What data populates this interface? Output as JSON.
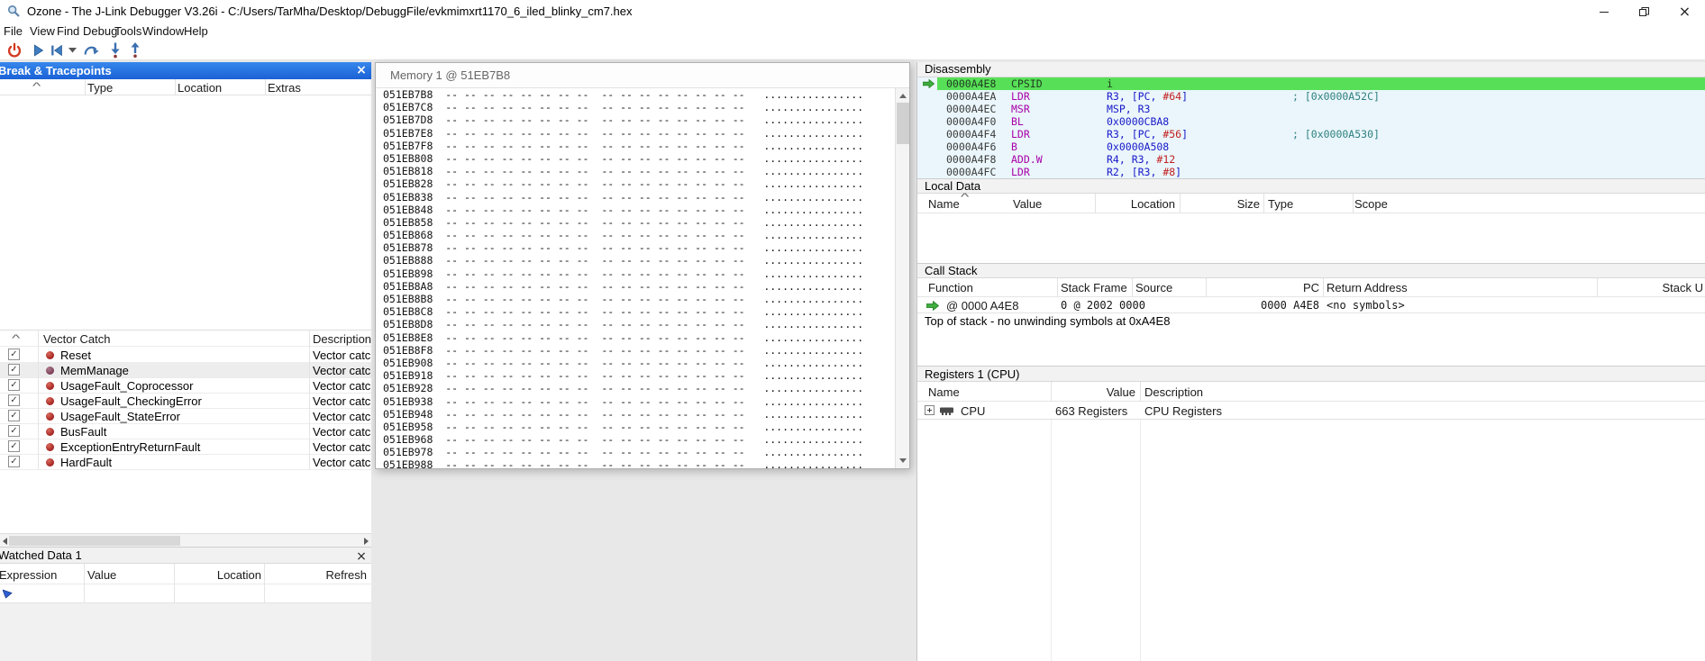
{
  "window": {
    "title": "Ozone - The J-Link Debugger V3.26i - C:/Users/TarMha/Desktop/DebuggFile/evkmimxrt1170_6_iled_blinky_cm7.hex"
  },
  "ui": {
    "close_glyph": "×"
  },
  "menu": {
    "items": [
      "File",
      "View",
      "Find",
      "Debug",
      "Tools",
      "Window",
      "Help"
    ]
  },
  "toolbar": {
    "icons": [
      "power",
      "start-debug",
      "reset",
      "reset-dropdown",
      "step-over",
      "step-into",
      "step-out"
    ]
  },
  "break_tracepoints": {
    "title": "Break & Tracepoints",
    "columns": [
      "Type",
      "Location",
      "Extras"
    ],
    "vector_catch": {
      "label": "Vector Catch",
      "description_header": "Description",
      "rows": [
        {
          "name": "Reset",
          "checked": true,
          "selected": false,
          "description": "Vector catch on"
        },
        {
          "name": "MemManage",
          "checked": true,
          "selected": true,
          "description": "Vector catch on"
        },
        {
          "name": "UsageFault_Coprocessor",
          "checked": true,
          "selected": false,
          "description": "Vector catch on"
        },
        {
          "name": "UsageFault_CheckingError",
          "checked": true,
          "selected": false,
          "description": "Vector catch on"
        },
        {
          "name": "UsageFault_StateError",
          "checked": true,
          "selected": false,
          "description": "Vector catch on"
        },
        {
          "name": "BusFault",
          "checked": true,
          "selected": false,
          "description": "Vector catch on"
        },
        {
          "name": "ExceptionEntryReturnFault",
          "checked": true,
          "selected": false,
          "description": "Vector catch on"
        },
        {
          "name": "HardFault",
          "checked": true,
          "selected": false,
          "description": "Vector catch on"
        }
      ]
    }
  },
  "watched_data": {
    "title": "Watched Data 1",
    "columns": [
      "Expression",
      "Value",
      "Location",
      "Refresh"
    ]
  },
  "memory_window": {
    "title": "Memory 1 @ 51EB7B8",
    "hex_pattern": "-- -- -- -- -- -- -- --  -- -- -- -- -- -- -- --",
    "ascii_pattern": "................",
    "addresses": [
      "051EB7B8",
      "051EB7C8",
      "051EB7D8",
      "051EB7E8",
      "051EB7F8",
      "051EB808",
      "051EB818",
      "051EB828",
      "051EB838",
      "051EB848",
      "051EB858",
      "051EB868",
      "051EB878",
      "051EB888",
      "051EB898",
      "051EB8A8",
      "051EB8B8",
      "051EB8C8",
      "051EB8D8",
      "051EB8E8",
      "051EB8F8",
      "051EB908",
      "051EB918",
      "051EB928",
      "051EB938",
      "051EB948",
      "051EB958",
      "051EB968",
      "051EB978",
      "051EB988"
    ]
  },
  "disassembly": {
    "title": "Disassembly",
    "rows": [
      {
        "address": "0000A4E8",
        "mnemonic": "CPSID",
        "operands": [
          {
            "text": "i",
            "type": "op"
          }
        ],
        "comment": "",
        "current": true
      },
      {
        "address": "0000A4EA",
        "mnemonic": "LDR",
        "operands": [
          {
            "text": "R3, [PC, ",
            "type": "op"
          },
          {
            "text": "#64",
            "type": "imm"
          },
          {
            "text": "]",
            "type": "op"
          }
        ],
        "comment": "; [0x0000A52C]",
        "current": false
      },
      {
        "address": "0000A4EC",
        "mnemonic": "MSR",
        "operands": [
          {
            "text": "MSP, R3",
            "type": "op"
          }
        ],
        "comment": "",
        "current": false
      },
      {
        "address": "0000A4F0",
        "mnemonic": "BL",
        "operands": [
          {
            "text": "0x0000CBA8",
            "type": "op"
          }
        ],
        "comment": "",
        "current": false
      },
      {
        "address": "0000A4F4",
        "mnemonic": "LDR",
        "operands": [
          {
            "text": "R3, [PC, ",
            "type": "op"
          },
          {
            "text": "#56",
            "type": "imm"
          },
          {
            "text": "]",
            "type": "op"
          }
        ],
        "comment": "; [0x0000A530]",
        "current": false
      },
      {
        "address": "0000A4F6",
        "mnemonic": "B",
        "operands": [
          {
            "text": "0x0000A508",
            "type": "op"
          }
        ],
        "comment": "",
        "current": false
      },
      {
        "address": "0000A4F8",
        "mnemonic": "ADD.W",
        "operands": [
          {
            "text": "R4, R3, ",
            "type": "op"
          },
          {
            "text": "#12",
            "type": "imm"
          }
        ],
        "comment": "",
        "current": false
      },
      {
        "address": "0000A4FC",
        "mnemonic": "LDR",
        "operands": [
          {
            "text": "R2, [R3, ",
            "type": "op"
          },
          {
            "text": "#8",
            "type": "imm"
          },
          {
            "text": "]",
            "type": "op"
          }
        ],
        "comment": "",
        "current": false
      }
    ]
  },
  "local_data": {
    "title": "Local Data",
    "columns": [
      "Name",
      "Value",
      "Location",
      "Size",
      "Type",
      "Scope"
    ]
  },
  "call_stack": {
    "title": "Call Stack",
    "columns": [
      "Function",
      "Stack Frame",
      "Source",
      "PC",
      "Return Address",
      "Stack U"
    ],
    "rows": [
      {
        "function": "@ 0000 A4E8",
        "stack_frame": "0 @ 2002 0000",
        "source": "",
        "pc": "0000 A4E8",
        "return_address": "<no symbols>"
      }
    ],
    "message": "Top of stack - no unwinding symbols at 0xA4E8"
  },
  "registers": {
    "title": "Registers 1 (CPU)",
    "columns": [
      "Name",
      "Value",
      "Description"
    ],
    "rows": [
      {
        "name": "CPU",
        "value": "663 Registers",
        "description": "CPU Registers"
      }
    ]
  },
  "colors": {
    "active_title_bar": "#2273e0",
    "current_line_green": "#57e057",
    "disasm_background": "#eaf6fb",
    "mnemonic": "#a800a8",
    "operand": "#1818c8",
    "immediate": "#c22020",
    "comment": "#2e8080",
    "breakpoint_red": "#a22020"
  }
}
